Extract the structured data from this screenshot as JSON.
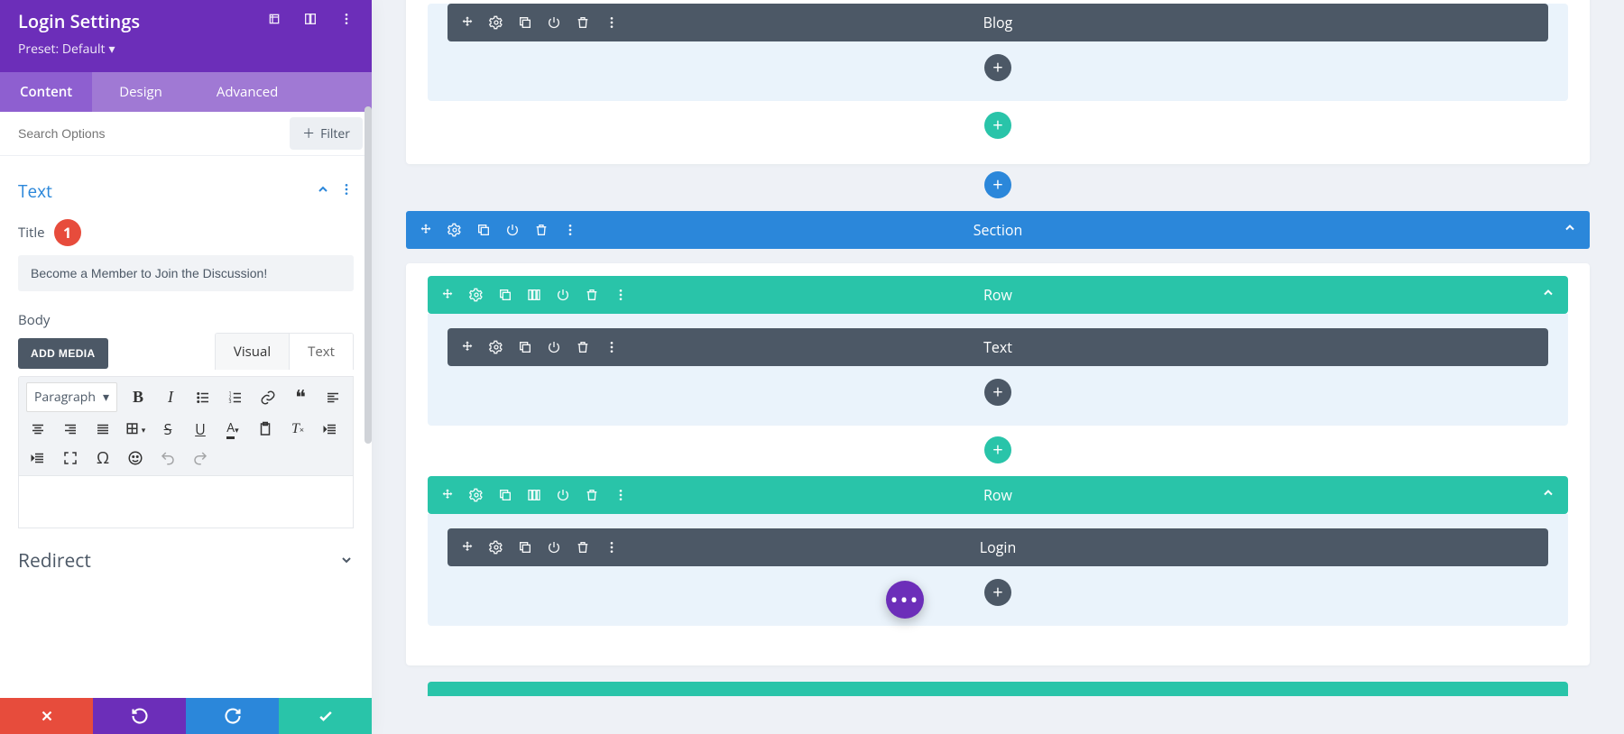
{
  "header": {
    "title": "Login Settings",
    "preset_label": "Preset: Default"
  },
  "tabs": {
    "content": "Content",
    "design": "Design",
    "advanced": "Advanced"
  },
  "search": {
    "placeholder": "Search Options",
    "filter_label": "Filter"
  },
  "text_section": {
    "title": "Text",
    "field_title_label": "Title",
    "badge_number": "1",
    "title_value": "Become a Member to Join the Discussion!",
    "body_label": "Body",
    "add_media_label": "ADD MEDIA",
    "editor_tabs": {
      "visual": "Visual",
      "text": "Text"
    },
    "paragraph_label": "Paragraph"
  },
  "redirect_section": {
    "title": "Redirect"
  },
  "canvas": {
    "module_blog": "Blog",
    "section_label": "Section",
    "row_label": "Row",
    "module_text": "Text",
    "module_login": "Login"
  }
}
